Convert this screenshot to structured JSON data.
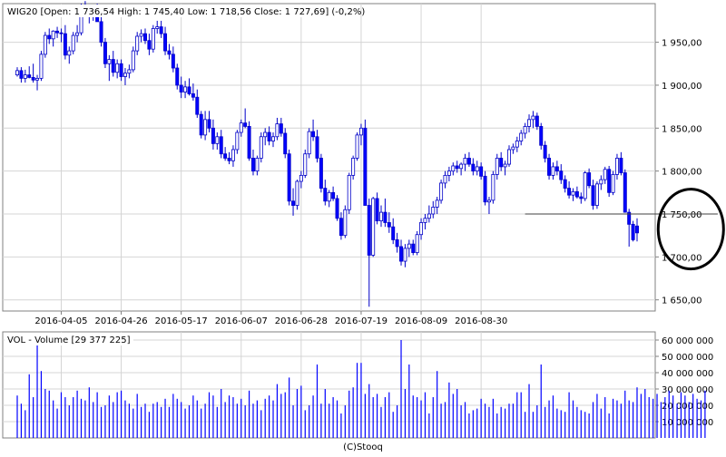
{
  "header": {
    "price_title": "WIG20 [Open: 1 736,54  High: 1 745,40  Low: 1 718,56  Close: 1 727,69] (-0,2%)",
    "volume_title": "VOL - Volume [29 377 225]",
    "footer": "(C)Stooq"
  },
  "colors": {
    "up_body": "#ffffff",
    "down_body": "#0000ff",
    "candle_outline": "#0000c8",
    "volume_bar": "#0000ff",
    "grid": "#d4d4d4",
    "frame": "#808080",
    "circle": "#000000"
  },
  "chart_data": [
    {
      "type": "candlestick",
      "title": "WIG20 [Open: 1 736,54  High: 1 745,40  Low: 1 718,56  Close: 1 727,69] (-0,2%)",
      "x_tick_labels": [
        "2016-04-05",
        "2016-04-26",
        "2016-05-17",
        "2016-06-07",
        "2016-06-28",
        "2016-07-19",
        "2016-08-09",
        "2016-08-30"
      ],
      "y_tick_values": [
        1650,
        1700,
        1750,
        1800,
        1850,
        1900,
        1950
      ],
      "y_tick_labels": [
        "1 650,00",
        "1 700,00",
        "1 750,00",
        "1 800,00",
        "1 850,00",
        "1 900,00",
        "1 950,00"
      ],
      "ylim": [
        1637,
        1995
      ],
      "grid": true,
      "annotations": [
        {
          "kind": "horizontal-line",
          "from_index": 127,
          "to_index": 172,
          "value": 1750
        },
        {
          "kind": "ellipse",
          "around_indices": [
            164,
            172
          ],
          "value_range": [
            1685,
            1780
          ]
        }
      ],
      "ohlc": [
        [
          1912,
          1921,
          1910,
          1917
        ],
        [
          1917,
          1921,
          1903,
          1908
        ],
        [
          1908,
          1918,
          1903,
          1912
        ],
        [
          1912,
          1922,
          1908,
          1909
        ],
        [
          1909,
          1925,
          1903,
          1906
        ],
        [
          1906,
          1912,
          1894,
          1908
        ],
        [
          1908,
          1940,
          1905,
          1936
        ],
        [
          1936,
          1962,
          1932,
          1958
        ],
        [
          1958,
          1966,
          1948,
          1954
        ],
        [
          1954,
          1964,
          1945,
          1963
        ],
        [
          1963,
          1968,
          1955,
          1961
        ],
        [
          1961,
          1966,
          1950,
          1960
        ],
        [
          1960,
          1970,
          1930,
          1935
        ],
        [
          1935,
          1945,
          1925,
          1940
        ],
        [
          1940,
          1962,
          1936,
          1958
        ],
        [
          1958,
          1970,
          1950,
          1961
        ],
        [
          1961,
          1995,
          1958,
          1992
        ],
        [
          1992,
          1998,
          1982,
          1988
        ],
        [
          1988,
          1992,
          1972,
          1983
        ],
        [
          1983,
          1992,
          1975,
          1989
        ],
        [
          1989,
          1995,
          1978,
          1974
        ],
        [
          1974,
          1980,
          1945,
          1950
        ],
        [
          1950,
          1955,
          1920,
          1925
        ],
        [
          1925,
          1935,
          1905,
          1930
        ],
        [
          1930,
          1940,
          1910,
          1915
        ],
        [
          1915,
          1930,
          1908,
          1925
        ],
        [
          1925,
          1930,
          1905,
          1910
        ],
        [
          1910,
          1920,
          1900,
          1914
        ],
        [
          1914,
          1924,
          1908,
          1918
        ],
        [
          1918,
          1945,
          1915,
          1940
        ],
        [
          1940,
          1962,
          1935,
          1957
        ],
        [
          1957,
          1965,
          1950,
          1960
        ],
        [
          1960,
          1966,
          1948,
          1952
        ],
        [
          1952,
          1960,
          1935,
          1942
        ],
        [
          1942,
          1970,
          1938,
          1966
        ],
        [
          1966,
          1975,
          1960,
          1968
        ],
        [
          1968,
          1975,
          1955,
          1960
        ],
        [
          1960,
          1968,
          1935,
          1940
        ],
        [
          1940,
          1948,
          1930,
          1936
        ],
        [
          1936,
          1945,
          1915,
          1920
        ],
        [
          1920,
          1925,
          1895,
          1900
        ],
        [
          1900,
          1910,
          1885,
          1892
        ],
        [
          1892,
          1905,
          1885,
          1898
        ],
        [
          1898,
          1908,
          1888,
          1890
        ],
        [
          1890,
          1902,
          1882,
          1886
        ],
        [
          1886,
          1895,
          1862,
          1866
        ],
        [
          1866,
          1870,
          1838,
          1842
        ],
        [
          1842,
          1870,
          1836,
          1860
        ],
        [
          1860,
          1870,
          1845,
          1850
        ],
        [
          1850,
          1860,
          1825,
          1832
        ],
        [
          1832,
          1845,
          1825,
          1840
        ],
        [
          1840,
          1848,
          1815,
          1820
        ],
        [
          1820,
          1828,
          1812,
          1815
        ],
        [
          1815,
          1822,
          1808,
          1812
        ],
        [
          1812,
          1830,
          1805,
          1825
        ],
        [
          1825,
          1848,
          1820,
          1845
        ],
        [
          1845,
          1860,
          1840,
          1856
        ],
        [
          1856,
          1873,
          1850,
          1852
        ],
        [
          1852,
          1858,
          1812,
          1815
        ],
        [
          1815,
          1825,
          1795,
          1800
        ],
        [
          1800,
          1818,
          1795,
          1815
        ],
        [
          1815,
          1845,
          1810,
          1840
        ],
        [
          1840,
          1850,
          1830,
          1845
        ],
        [
          1845,
          1852,
          1830,
          1835
        ],
        [
          1835,
          1845,
          1828,
          1840
        ],
        [
          1840,
          1862,
          1836,
          1855
        ],
        [
          1855,
          1862,
          1840,
          1844
        ],
        [
          1844,
          1850,
          1815,
          1820
        ],
        [
          1820,
          1825,
          1760,
          1765
        ],
        [
          1765,
          1780,
          1748,
          1760
        ],
        [
          1760,
          1790,
          1755,
          1788
        ],
        [
          1788,
          1800,
          1780,
          1795
        ],
        [
          1795,
          1825,
          1792,
          1820
        ],
        [
          1820,
          1850,
          1815,
          1846
        ],
        [
          1846,
          1860,
          1835,
          1840
        ],
        [
          1840,
          1848,
          1810,
          1815
        ],
        [
          1815,
          1820,
          1775,
          1780
        ],
        [
          1780,
          1790,
          1760,
          1765
        ],
        [
          1765,
          1778,
          1758,
          1775
        ],
        [
          1775,
          1782,
          1765,
          1768
        ],
        [
          1768,
          1772,
          1742,
          1745
        ],
        [
          1745,
          1752,
          1720,
          1725
        ],
        [
          1725,
          1760,
          1722,
          1755
        ],
        [
          1755,
          1798,
          1750,
          1795
        ],
        [
          1795,
          1818,
          1790,
          1815
        ],
        [
          1815,
          1845,
          1812,
          1842
        ],
        [
          1842,
          1855,
          1830,
          1850
        ],
        [
          1850,
          1860,
          1790,
          1760
        ],
        [
          1760,
          1768,
          1642,
          1702
        ],
        [
          1702,
          1770,
          1700,
          1768
        ],
        [
          1768,
          1775,
          1738,
          1742
        ],
        [
          1742,
          1760,
          1735,
          1752
        ],
        [
          1752,
          1768,
          1735,
          1740
        ],
        [
          1740,
          1752,
          1728,
          1735
        ],
        [
          1735,
          1745,
          1715,
          1720
        ],
        [
          1720,
          1728,
          1705,
          1712
        ],
        [
          1712,
          1720,
          1690,
          1695
        ],
        [
          1695,
          1715,
          1688,
          1710
        ],
        [
          1710,
          1720,
          1700,
          1715
        ],
        [
          1715,
          1720,
          1702,
          1705
        ],
        [
          1705,
          1730,
          1702,
          1726
        ],
        [
          1726,
          1745,
          1720,
          1740
        ],
        [
          1740,
          1750,
          1732,
          1745
        ],
        [
          1745,
          1760,
          1740,
          1750
        ],
        [
          1750,
          1765,
          1745,
          1758
        ],
        [
          1758,
          1770,
          1750,
          1766
        ],
        [
          1766,
          1790,
          1762,
          1786
        ],
        [
          1786,
          1800,
          1780,
          1795
        ],
        [
          1795,
          1805,
          1788,
          1800
        ],
        [
          1800,
          1810,
          1795,
          1806
        ],
        [
          1806,
          1812,
          1798,
          1803
        ],
        [
          1803,
          1810,
          1795,
          1808
        ],
        [
          1808,
          1820,
          1800,
          1815
        ],
        [
          1815,
          1822,
          1805,
          1808
        ],
        [
          1808,
          1815,
          1795,
          1800
        ],
        [
          1800,
          1812,
          1795,
          1805
        ],
        [
          1805,
          1810,
          1790,
          1794
        ],
        [
          1794,
          1800,
          1760,
          1764
        ],
        [
          1764,
          1770,
          1750,
          1766
        ],
        [
          1766,
          1800,
          1762,
          1796
        ],
        [
          1796,
          1820,
          1790,
          1815
        ],
        [
          1815,
          1822,
          1800,
          1805
        ],
        [
          1805,
          1812,
          1795,
          1808
        ],
        [
          1808,
          1830,
          1805,
          1825
        ],
        [
          1825,
          1832,
          1820,
          1828
        ],
        [
          1828,
          1840,
          1822,
          1835
        ],
        [
          1835,
          1848,
          1830,
          1844
        ],
        [
          1844,
          1856,
          1838,
          1852
        ],
        [
          1852,
          1866,
          1845,
          1860
        ],
        [
          1860,
          1870,
          1850,
          1864
        ],
        [
          1864,
          1868,
          1848,
          1852
        ],
        [
          1852,
          1856,
          1825,
          1830
        ],
        [
          1830,
          1835,
          1810,
          1815
        ],
        [
          1815,
          1820,
          1790,
          1795
        ],
        [
          1795,
          1810,
          1790,
          1805
        ],
        [
          1805,
          1812,
          1795,
          1800
        ],
        [
          1800,
          1808,
          1785,
          1790
        ],
        [
          1790,
          1795,
          1775,
          1780
        ],
        [
          1780,
          1788,
          1768,
          1772
        ],
        [
          1772,
          1780,
          1765,
          1776
        ],
        [
          1776,
          1782,
          1768,
          1770
        ],
        [
          1770,
          1775,
          1762,
          1768
        ],
        [
          1768,
          1800,
          1765,
          1798
        ],
        [
          1798,
          1803,
          1780,
          1783
        ],
        [
          1783,
          1790,
          1755,
          1760
        ],
        [
          1760,
          1788,
          1756,
          1785
        ],
        [
          1785,
          1795,
          1778,
          1790
        ],
        [
          1790,
          1805,
          1785,
          1802
        ],
        [
          1802,
          1806,
          1770,
          1775
        ],
        [
          1775,
          1800,
          1772,
          1796
        ],
        [
          1796,
          1820,
          1790,
          1815
        ],
        [
          1815,
          1822,
          1795,
          1798
        ],
        [
          1798,
          1802,
          1758,
          1752
        ],
        [
          1752,
          1756,
          1712,
          1738
        ],
        [
          1738,
          1742,
          1718,
          1720
        ],
        [
          1736,
          1745,
          1718,
          1728
        ]
      ]
    },
    {
      "type": "bar",
      "title": "VOL - Volume [29 377 225]",
      "y_tick_values": [
        10000000,
        20000000,
        30000000,
        40000000,
        50000000,
        60000000
      ],
      "y_tick_labels": [
        "10 000 000",
        "20 000 000",
        "30 000 000",
        "40 000 000",
        "50 000 000",
        "60 000 000"
      ],
      "ylim": [
        0,
        65000000
      ],
      "values": [
        26000000,
        21000000,
        17000000,
        39000000,
        25000000,
        63000000,
        41000000,
        30000000,
        29000000,
        23000000,
        18000000,
        28000000,
        25000000,
        20000000,
        25000000,
        29000000,
        24000000,
        23000000,
        31000000,
        22000000,
        28000000,
        19000000,
        20000000,
        26000000,
        22000000,
        28000000,
        29000000,
        23000000,
        21000000,
        18000000,
        27000000,
        19000000,
        21000000,
        16000000,
        21000000,
        22000000,
        19000000,
        24000000,
        19000000,
        27000000,
        24000000,
        22000000,
        18000000,
        20000000,
        26000000,
        23000000,
        18000000,
        21000000,
        28000000,
        26000000,
        19000000,
        30000000,
        22000000,
        26000000,
        25000000,
        21000000,
        24000000,
        20000000,
        29000000,
        21000000,
        23000000,
        17000000,
        24000000,
        26000000,
        23000000,
        33000000,
        27000000,
        28000000,
        37000000,
        20000000,
        30000000,
        32000000,
        17000000,
        20000000,
        26000000,
        45000000,
        21000000,
        30000000,
        21000000,
        25000000,
        23000000,
        15000000,
        20000000,
        29000000,
        31000000,
        46000000,
        46000000,
        27000000,
        33000000,
        25000000,
        27000000,
        19000000,
        25000000,
        28000000,
        16000000,
        20000000,
        60000000,
        30000000,
        45000000,
        26000000,
        25000000,
        23000000,
        28000000,
        15000000,
        25000000,
        41000000,
        21000000,
        22000000,
        34000000,
        27000000,
        30000000,
        20000000,
        22000000,
        15000000,
        17000000,
        18000000,
        24000000,
        21000000,
        19000000,
        24000000,
        15000000,
        19000000,
        18000000,
        21000000,
        21000000,
        28000000,
        28000000,
        16000000,
        33000000,
        16000000,
        20000000,
        45000000,
        19000000,
        23000000,
        26000000,
        18000000,
        17000000,
        16000000,
        28000000,
        23000000,
        19000000,
        17000000,
        16000000,
        15000000,
        22000000,
        27000000,
        18000000,
        25000000,
        15000000,
        24000000,
        23000000,
        21000000,
        29000000,
        23000000,
        22000000,
        31000000,
        27000000,
        30000000,
        25000000,
        24000000,
        27000000,
        22000000,
        25000000,
        29000000,
        26000000,
        21000000,
        28000000,
        26000000,
        22000000,
        27000000,
        24000000,
        23000000,
        29000000
      ]
    }
  ]
}
